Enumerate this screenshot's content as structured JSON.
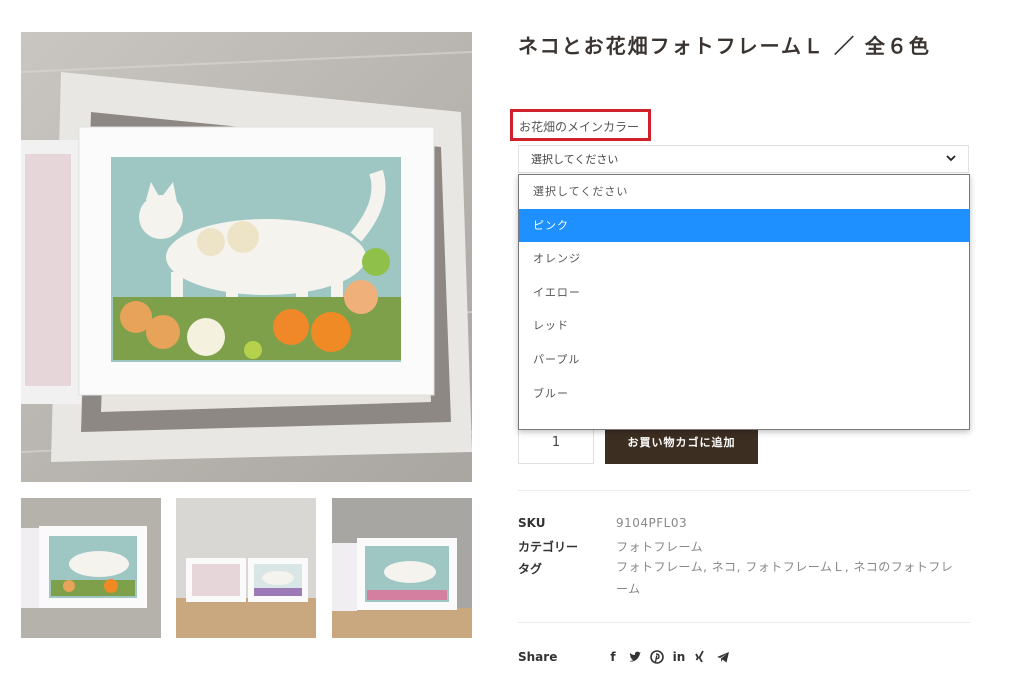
{
  "product": {
    "title": "ネコとお花畑フォトフレームＬ ／ 全６色"
  },
  "variation": {
    "label": "お花畑のメインカラー",
    "selected": "選択してください",
    "options": [
      "選択してください",
      "ピンク",
      "オレンジ",
      "イエロー",
      "レッド",
      "パープル",
      "ブルー"
    ],
    "highlighted_index": 1,
    "highlight_color": "#1e90ff",
    "label_border_color": "#d0202a"
  },
  "cart": {
    "quantity": "1",
    "add_button": "お買い物カゴに追加",
    "button_color": "#3d2e22"
  },
  "meta": {
    "sku_label": "SKU",
    "sku_value": "9104PFL03",
    "category_label": "カテゴリー",
    "category_value": "フォトフレーム",
    "tag_label": "タグ",
    "tags": [
      "フォトフレーム",
      "ネコ",
      "フォトフレームＬ",
      "ネコのフォトフレーム"
    ]
  },
  "share": {
    "label": "Share",
    "icons": [
      "facebook-icon",
      "twitter-icon",
      "pinterest-icon",
      "linkedin-icon",
      "xing-icon",
      "telegram-icon"
    ]
  }
}
